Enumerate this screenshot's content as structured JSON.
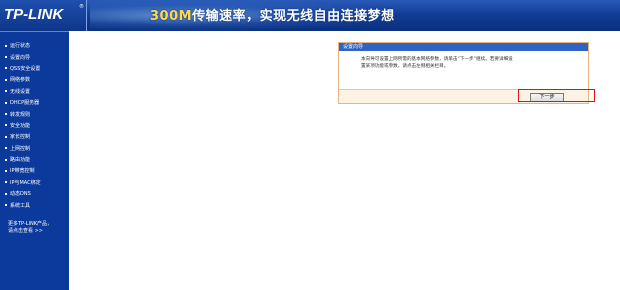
{
  "header": {
    "logo": "TP-LINK",
    "logo_mark": "®",
    "slogan_highlight": "300M",
    "slogan_text": "传输速率，实现无线自由连接梦想"
  },
  "sidebar": {
    "items": [
      {
        "label": "运行状态"
      },
      {
        "label": "设置向导"
      },
      {
        "label": "QSS安全设置"
      },
      {
        "label": "网络参数"
      },
      {
        "label": "无线设置"
      },
      {
        "label": "DHCP服务器"
      },
      {
        "label": "转发规则"
      },
      {
        "label": "安全功能"
      },
      {
        "label": "家长控制"
      },
      {
        "label": "上网控制"
      },
      {
        "label": "路由功能"
      },
      {
        "label": "IP带宽控制"
      },
      {
        "label": "IP与MAC绑定"
      },
      {
        "label": "动态DNS"
      },
      {
        "label": "系统工具"
      }
    ],
    "promo_line1": "更多TP-LINK产品，",
    "promo_line2": "请点击查看 >>"
  },
  "dialog": {
    "title": "设置向导",
    "desc_line1": "本向导可设置上网所需的基本网络参数，请单击“下一步”继续。若要详细设",
    "desc_line2": "置某项功能或参数，请点击左侧相关栏目。",
    "next_label": "下一步"
  },
  "colors": {
    "header_blue": "#123e96",
    "sidebar_blue": "#0c3a9c",
    "dialog_title": "#2f64c4",
    "highlight_red": "#e0101a",
    "slogan_accent": "#ffd84a"
  }
}
